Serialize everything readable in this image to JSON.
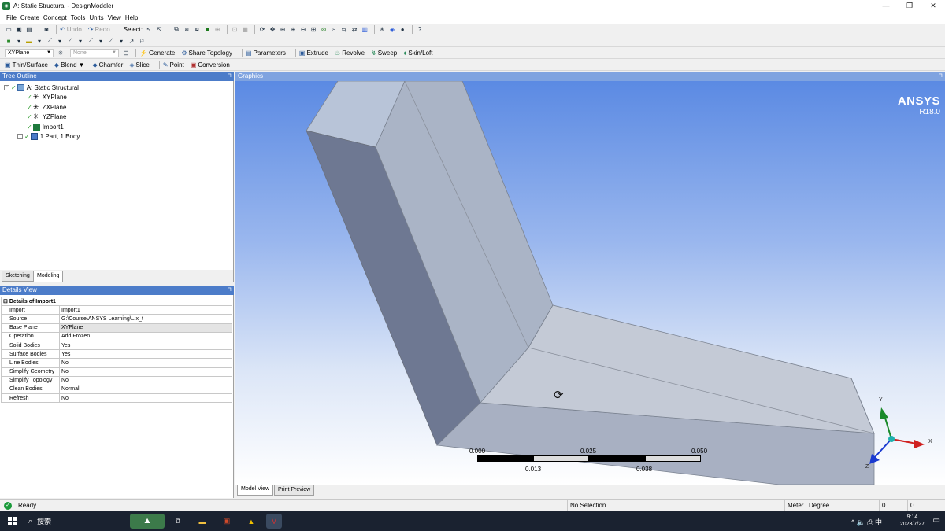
{
  "window": {
    "title": "A: Static Structural - DesignModeler",
    "app_icon": "ansys-workbench-icon",
    "controls": [
      "—",
      "❐",
      "✕"
    ]
  },
  "menu": [
    "File",
    "Create",
    "Concept",
    "Tools",
    "Units",
    "View",
    "Help"
  ],
  "toolbar1": {
    "undo_label": "Undo",
    "redo_label": "Redo",
    "select_label": "Select:"
  },
  "toolbar3": {
    "plane_combo": "XYPlane",
    "sketch_combo": "None",
    "generate": "Generate",
    "share_topology": "Share Topology",
    "parameters": "Parameters",
    "extrude": "Extrude",
    "revolve": "Revolve",
    "sweep": "Sweep",
    "skin_loft": "Skin/Loft"
  },
  "toolbar4": {
    "thin_surface": "Thin/Surface",
    "blend": "Blend",
    "chamfer": "Chamfer",
    "slice": "Slice",
    "point": "Point",
    "conversion": "Conversion"
  },
  "tree_outline": {
    "header": "Tree Outline",
    "pin": "⊓",
    "root": "A: Static Structural",
    "items": [
      "XYPlane",
      "ZXPlane",
      "YZPlane",
      "Import1",
      "1 Part, 1 Body"
    ]
  },
  "left_tabs": [
    "Sketching",
    "Modeling"
  ],
  "details_view": {
    "header": "Details View",
    "pin": "⊓",
    "group_title": "Details of Import1",
    "rows": [
      {
        "name": "Import",
        "value": "Import1"
      },
      {
        "name": "Source",
        "value": "G:\\Course\\ANSYS Learning\\L.x_t"
      },
      {
        "name": "Base Plane",
        "value": "XYPlane"
      },
      {
        "name": "Operation",
        "value": "Add Frozen"
      },
      {
        "name": "Solid Bodies",
        "value": "Yes"
      },
      {
        "name": "Surface Bodies",
        "value": "Yes"
      },
      {
        "name": "Line Bodies",
        "value": "No"
      },
      {
        "name": "Simplify Geometry",
        "value": "No"
      },
      {
        "name": "Simplify Topology",
        "value": "No"
      },
      {
        "name": "Clean Bodies",
        "value": "Normal"
      },
      {
        "name": "Refresh",
        "value": "No"
      }
    ]
  },
  "graphics": {
    "header": "Graphics",
    "pin": "⊓",
    "brand": "ANSYS",
    "version": "R18.0",
    "scale_top": [
      "0.000",
      "0.025",
      "0.050 (m)"
    ],
    "scale_bottom": [
      "0.013",
      "0.038"
    ],
    "axis_labels": {
      "x": "X",
      "y": "Y",
      "z": "Z"
    },
    "cursor_icon": "rotate-cursor-icon"
  },
  "bottom_tabs": [
    "Model View",
    "Print Preview"
  ],
  "status": {
    "state": "Ready",
    "selection": "No Selection",
    "units_length": "Meter",
    "units_angle": "Degree",
    "val1": "0",
    "val2": "0"
  },
  "taskbar": {
    "search_label": "搜索",
    "time": "9:14",
    "date": "2023/7/27",
    "tray": "^ 🔈 ⎙ 中"
  }
}
